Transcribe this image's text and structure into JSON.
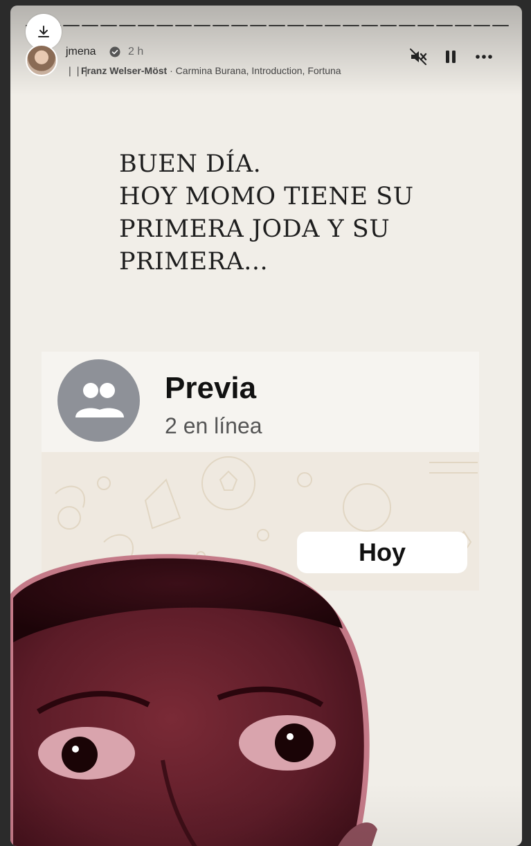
{
  "story": {
    "username": "jmena",
    "time_ago": "2 h",
    "music_artist": "Franz Welser-Möst",
    "music_separator": " · ",
    "music_title": "Carmina Burana, Introduction, Fortuna",
    "progress_segments": 26,
    "active_segment_index": 25
  },
  "icons": {
    "download": "download-icon",
    "verified": "verified-badge-icon",
    "mute": "speaker-muted-icon",
    "pause": "pause-icon",
    "more": "more-horizontal-icon"
  },
  "content": {
    "greeting_lines": [
      "BUEN DÍA.",
      "HOY MOMO TIENE SU",
      "PRIMERA JODA Y SU",
      "PRIMERA..."
    ],
    "chat_name": "Previa",
    "chat_status": "2 en línea",
    "date_pill": "Hoy"
  },
  "colors": {
    "story_bg": "#f1eee8",
    "chat_icon": "#8e9198",
    "pill_bg": "#ffffff"
  }
}
